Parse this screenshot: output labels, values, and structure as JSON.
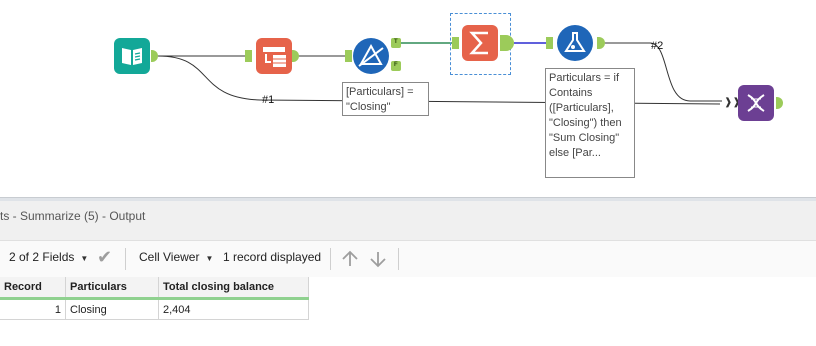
{
  "canvas": {
    "tools": [
      {
        "name": "input-data-tool-icon",
        "color": "#11a896"
      },
      {
        "name": "select-records-tool-icon",
        "color": "#e05d44"
      },
      {
        "name": "filter-tool-icon",
        "color": "#1e64b5"
      },
      {
        "name": "summarize-tool-icon",
        "color": "#e05d44"
      },
      {
        "name": "formula-tool-icon",
        "color": "#1e64b5"
      },
      {
        "name": "join-multiple-tool-icon",
        "color": "#6b3f91"
      }
    ],
    "filter_true_label": "T",
    "filter_false_label": "F",
    "connection_1_label": "#1",
    "connection_2_label": "#2",
    "filter_annotation": "[Particulars] = \"Closing\"",
    "formula_annotation": "Particulars = if Contains ([Particulars], \"Closing\") then \"Sum Closing\" else [Par..."
  },
  "results": {
    "title": "ts - Summarize (5) - Output",
    "fields_selector": "2 of 2 Fields",
    "viewer_selector": "Cell Viewer",
    "record_count": "1 record displayed"
  },
  "grid": {
    "columns": [
      "Record",
      "Particulars",
      "Total closing balance"
    ],
    "rows": [
      [
        "1",
        "Closing",
        "2,404"
      ]
    ]
  }
}
